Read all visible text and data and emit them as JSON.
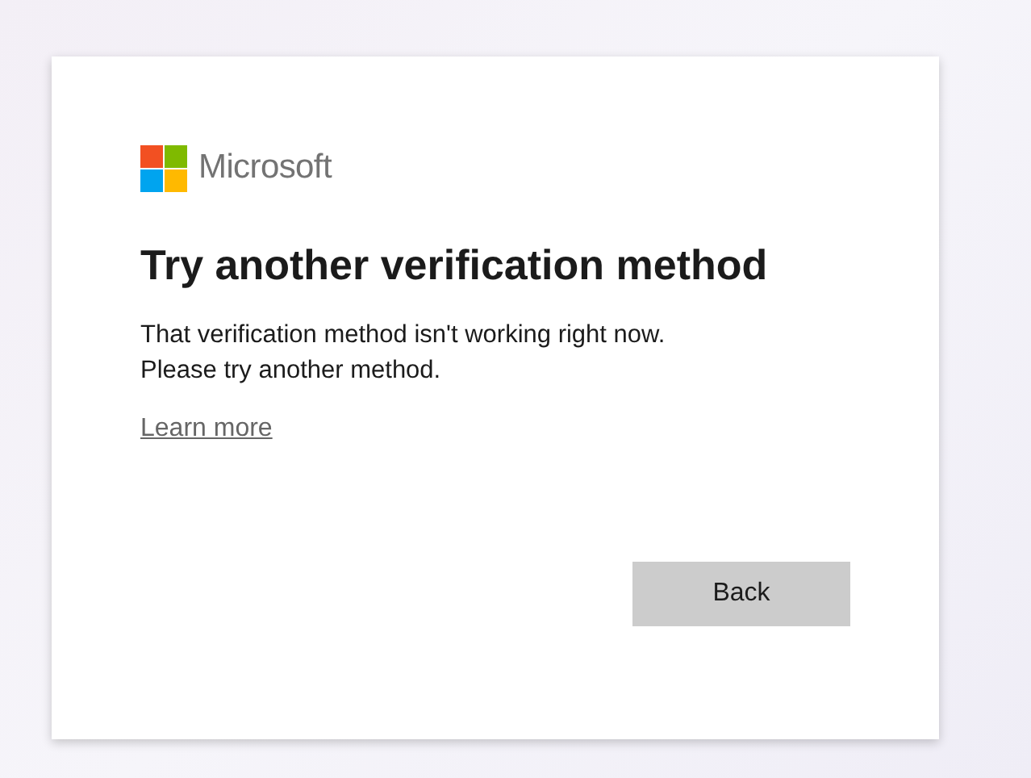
{
  "brand": {
    "name": "Microsoft"
  },
  "title": "Try another verification method",
  "message": [
    "That verification method isn't working right now.",
    "Please try another method."
  ],
  "link": "Learn more",
  "buttons": [
    "Back"
  ]
}
